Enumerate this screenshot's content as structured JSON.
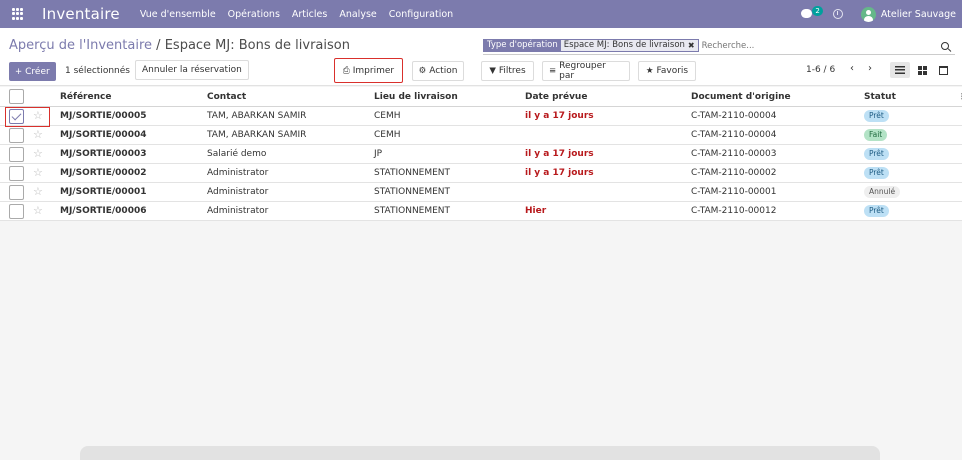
{
  "topbar": {
    "app_title": "Inventaire",
    "menu": [
      "Vue d'ensemble",
      "Opérations",
      "Articles",
      "Analyse",
      "Configuration"
    ],
    "chat_count": "2",
    "company": "Atelier Sauvage",
    "color": "#7c7bad"
  },
  "control": {
    "breadcrumb_parent": "Aperçu de l'Inventaire",
    "breadcrumb_sep": "/",
    "breadcrumb_current": "Espace MJ: Bons de livraison",
    "facet_key": "Type d'opération",
    "facet_value": "Espace MJ: Bons de livraison",
    "search_placeholder": "Recherche...",
    "create_label": "Créer",
    "selected_text": "1 sélectionnés",
    "cancel_reservation": "Annuler la réservation",
    "print_label": "Imprimer",
    "action_label": "Action",
    "filters_label": "Filtres",
    "group_by_label": "Regrouper par",
    "favorites_label": "Favoris",
    "pager": "1-6 / 6"
  },
  "table": {
    "headers": [
      "Référence",
      "Contact",
      "Lieu de livraison",
      "Date prévue",
      "Document d'origine",
      "Statut"
    ],
    "rows": [
      {
        "ref": "MJ/SORTIE/00005",
        "contact": "TAM, ABARKAN SAMIR",
        "loc": "CEMH",
        "date": "il y a 17 jours",
        "orig": "C-TAM-2110-00004",
        "status": "Prêt",
        "checked": true
      },
      {
        "ref": "MJ/SORTIE/00004",
        "contact": "TAM, ABARKAN SAMIR",
        "loc": "CEMH",
        "date": "",
        "orig": "C-TAM-2110-00004",
        "status": "Fait",
        "checked": false
      },
      {
        "ref": "MJ/SORTIE/00003",
        "contact": "Salarié demo",
        "loc": "JP",
        "date": "il y a 17 jours",
        "orig": "C-TAM-2110-00003",
        "status": "Prêt",
        "checked": false
      },
      {
        "ref": "MJ/SORTIE/00002",
        "contact": "Administrator",
        "loc": "STATIONNEMENT",
        "date": "il y a 17 jours",
        "orig": "C-TAM-2110-00002",
        "status": "Prêt",
        "checked": false
      },
      {
        "ref": "MJ/SORTIE/00001",
        "contact": "Administrator",
        "loc": "STATIONNEMENT",
        "date": "",
        "orig": "C-TAM-2110-00001",
        "status": "Annulé",
        "checked": false
      },
      {
        "ref": "MJ/SORTIE/00006",
        "contact": "Administrator",
        "loc": "STATIONNEMENT",
        "date": "Hier",
        "orig": "C-TAM-2110-00012",
        "status": "Prêt",
        "checked": false
      }
    ]
  }
}
